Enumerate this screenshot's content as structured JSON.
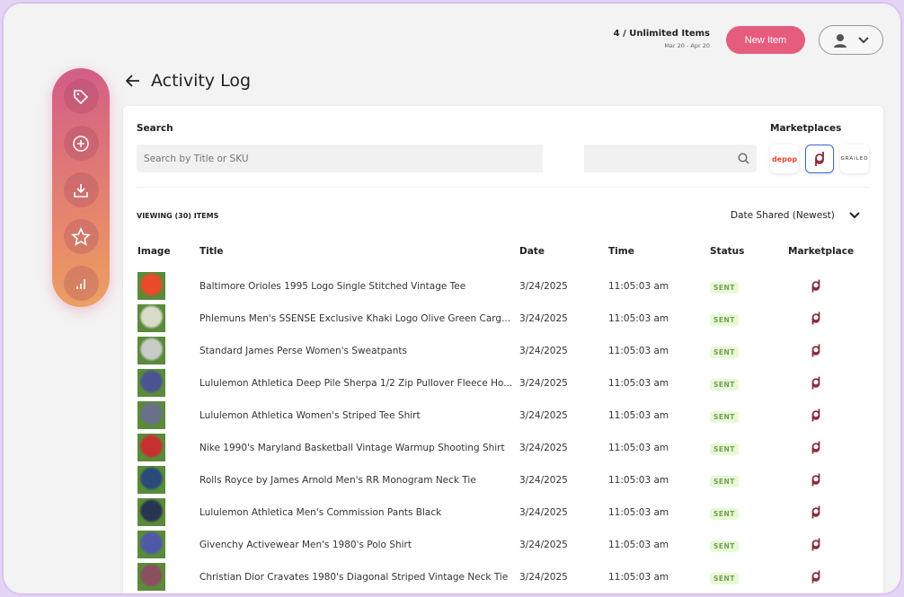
{
  "header": {
    "usage": "4 / Unlimited Items",
    "period": "Mar 20 - Apr 20",
    "new_item": "New Item"
  },
  "sidebar": [
    "tag-icon",
    "plus-circle-icon",
    "download-icon",
    "star-icon",
    "bar-chart-icon"
  ],
  "page": {
    "title": "Activity Log"
  },
  "search": {
    "label": "Search",
    "placeholder": "Search by Title or SKU"
  },
  "marketplaces": {
    "label": "Marketplaces",
    "items": [
      "depop",
      "poshmark",
      "GRAILED"
    ],
    "selected": "poshmark"
  },
  "list": {
    "viewing": "VIEWING (30) ITEMS",
    "sort": "Date Shared (Newest)",
    "columns": [
      "Image",
      "Title",
      "Date",
      "Time",
      "Status",
      "Marketplace"
    ],
    "rows": [
      {
        "title": "Baltimore Orioles 1995 Logo Single Stitched Vintage Tee",
        "date": "3/24/2025",
        "time": "11:05:03 am",
        "status": "SENT",
        "color": "#e84a2a"
      },
      {
        "title": "Phlemuns Men's SSENSE Exclusive Khaki Logo Olive Green Carg...",
        "date": "3/24/2025",
        "time": "11:05:03 am",
        "status": "SENT",
        "color": "#d8dcc8"
      },
      {
        "title": "Standard James Perse Women's Sweatpants",
        "date": "3/24/2025",
        "time": "11:05:03 am",
        "status": "SENT",
        "color": "#c8ccc8"
      },
      {
        "title": "Lululemon Athletica Deep Pile Sherpa 1/2 Zip Pullover Fleece Ho...",
        "date": "3/24/2025",
        "time": "11:05:03 am",
        "status": "SENT",
        "color": "#4a5490"
      },
      {
        "title": "Lululemon Athletica Women's Striped Tee Shirt",
        "date": "3/24/2025",
        "time": "11:05:03 am",
        "status": "SENT",
        "color": "#6a7088"
      },
      {
        "title": "Nike 1990's Maryland Basketball Vintage Warmup Shooting Shirt",
        "date": "3/24/2025",
        "time": "11:05:03 am",
        "status": "SENT",
        "color": "#c83030"
      },
      {
        "title": "Rolls Royce by James Arnold Men's RR Monogram Neck Tie",
        "date": "3/24/2025",
        "time": "11:05:03 am",
        "status": "SENT",
        "color": "#2a4a78"
      },
      {
        "title": "Lululemon Athletica Men's Commission Pants Black",
        "date": "3/24/2025",
        "time": "11:05:03 am",
        "status": "SENT",
        "color": "#283450"
      },
      {
        "title": "Givenchy Activewear Men's 1980's Polo Shirt",
        "date": "3/24/2025",
        "time": "11:05:03 am",
        "status": "SENT",
        "color": "#5058a8"
      },
      {
        "title": "Christian Dior Cravates 1980's Diagonal Striped Vintage Neck Tie",
        "date": "3/24/2025",
        "time": "11:05:03 am",
        "status": "SENT",
        "color": "#8a5060"
      }
    ]
  },
  "colors": {
    "accent": "#e65c7e",
    "sent_bg": "#e6fbd5",
    "poshmark": "#8a2a3a"
  }
}
